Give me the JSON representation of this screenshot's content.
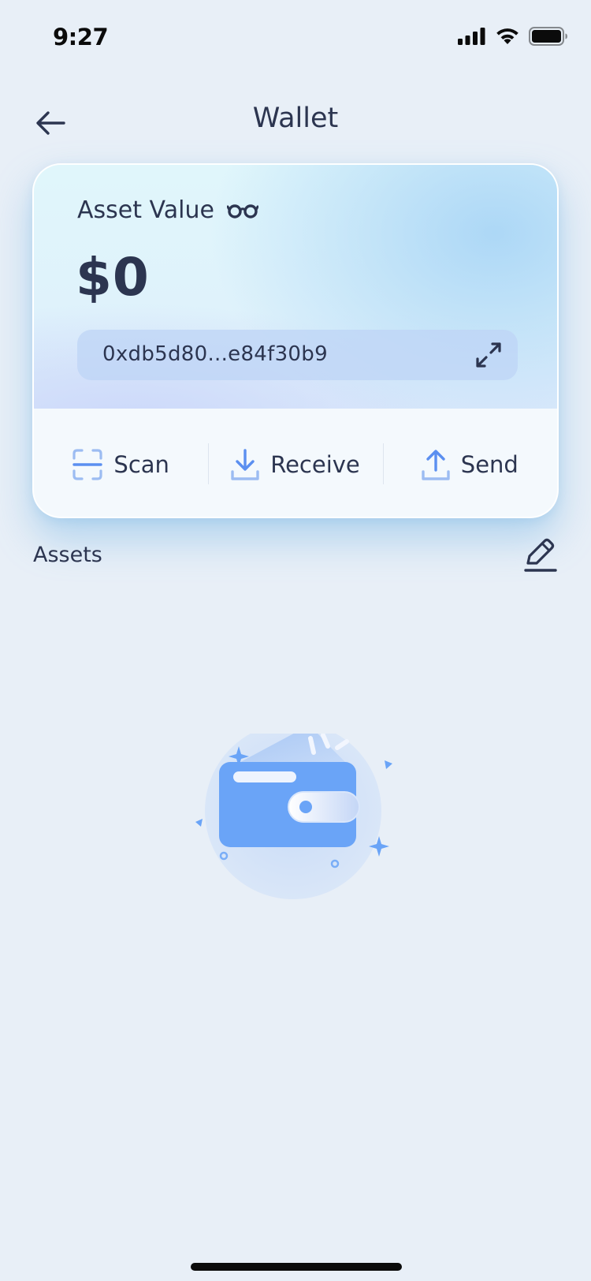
{
  "status_bar": {
    "time": "9:27",
    "icons": [
      "cellular-signal-icon",
      "wifi-icon",
      "battery-icon"
    ]
  },
  "header": {
    "title": "Wallet",
    "back_icon": "arrow-left-icon"
  },
  "wallet_card": {
    "asset_label": "Asset Value",
    "visibility_icon": "glasses-icon",
    "asset_value": "$0",
    "address": "0xdb5d80...e84f30b9",
    "expand_icon": "expand-arrows-icon",
    "actions": [
      {
        "label": "Scan",
        "icon": "scan-icon"
      },
      {
        "label": "Receive",
        "icon": "download-icon"
      },
      {
        "label": "Send",
        "icon": "upload-icon"
      }
    ]
  },
  "assets": {
    "title": "Assets",
    "edit_icon": "pencil-edit-icon"
  },
  "empty_state": {
    "illustration": "empty-wallet-illustration"
  },
  "colors": {
    "background": "#e8eff7",
    "text": "#2c3550",
    "accent_blue": "#6aa4f7",
    "icon_light_blue": "#9cbcf2"
  }
}
